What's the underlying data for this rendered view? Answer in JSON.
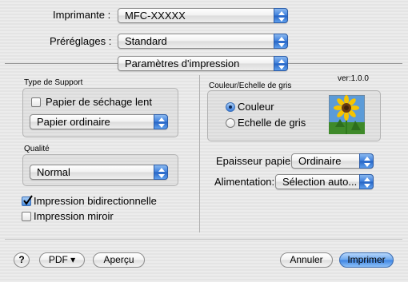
{
  "printer": {
    "label": "Imprimante :",
    "value": "MFC-XXXXX"
  },
  "presets": {
    "label": "Préréglages :",
    "value": "Standard"
  },
  "panel": {
    "value": "Paramètres d'impression"
  },
  "media": {
    "group_label": "Type de Support",
    "dry_paper_label": "Papier de séchage lent",
    "dry_paper_checked": false,
    "paper_type_value": "Papier ordinaire"
  },
  "quality": {
    "group_label": "Qualité",
    "value": "Normal"
  },
  "bidirectional": {
    "label": "Impression bidirectionnelle",
    "checked": true
  },
  "mirror": {
    "label": "Impression miroir",
    "checked": false
  },
  "version": "ver:1.0.0",
  "color": {
    "group_label": "Couleur/Echelle de gris",
    "options": [
      "Couleur",
      "Echelle de gris"
    ],
    "selected": "Couleur",
    "preview_icon": "sunflower-image-icon"
  },
  "thickness": {
    "label": "Epaisseur papier:",
    "value": "Ordinaire"
  },
  "feed": {
    "label": "Alimentation:",
    "value": "Sélection auto..."
  },
  "buttons": {
    "help": "?",
    "pdf": "PDF ▾",
    "preview": "Aperçu",
    "cancel": "Annuler",
    "print": "Imprimer"
  },
  "colors": {
    "accent": "#3d7fdc",
    "background": "#e8e8e8"
  }
}
